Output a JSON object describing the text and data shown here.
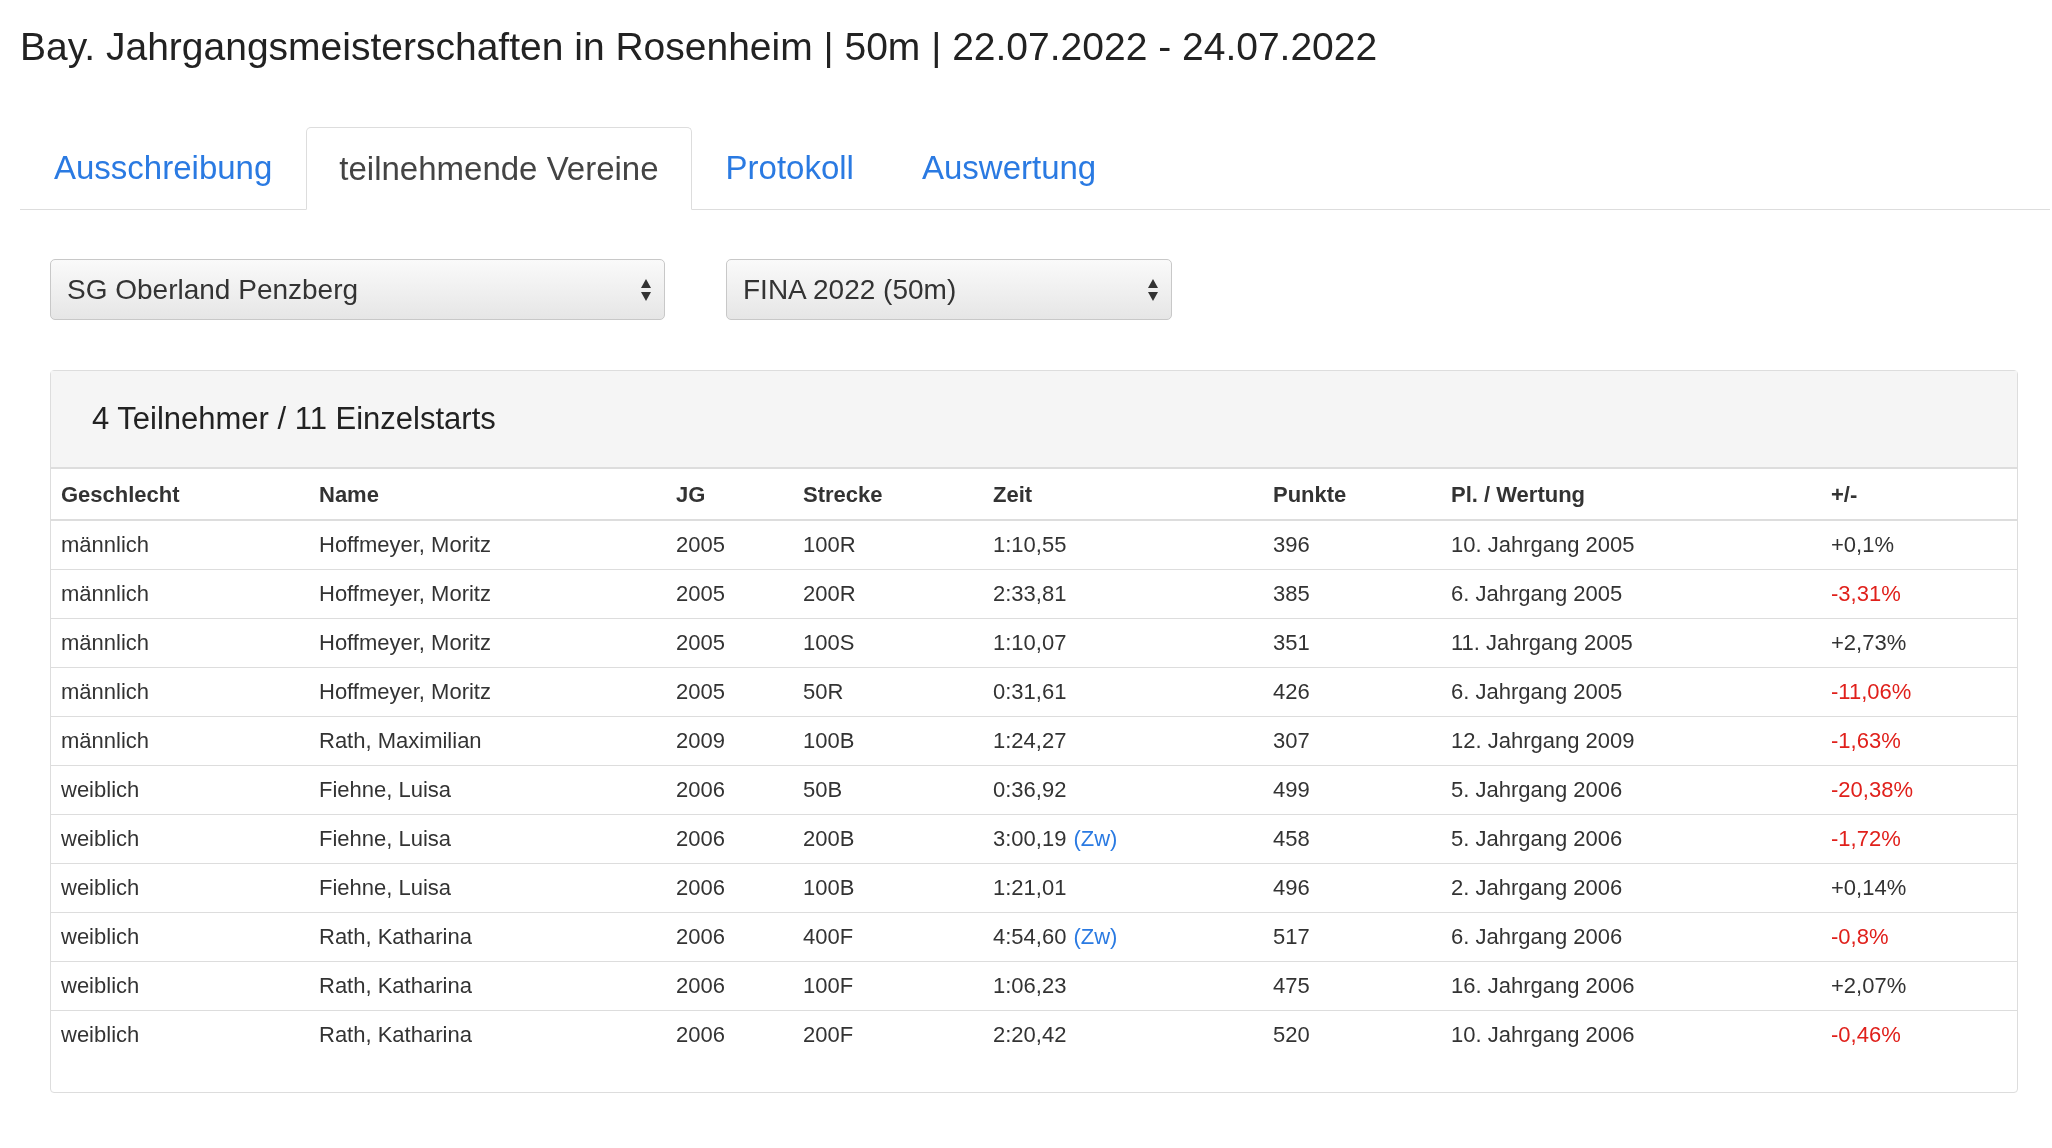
{
  "title": "Bay. Jahrgangsmeisterschaften in Rosenheim | 50m | 22.07.2022 - 24.07.2022",
  "tabs": [
    {
      "label": "Ausschreibung",
      "selected": false
    },
    {
      "label": "teilnehmende Vereine",
      "selected": true
    },
    {
      "label": "Protokoll",
      "selected": false
    },
    {
      "label": "Auswertung",
      "selected": false
    }
  ],
  "selects": [
    {
      "value": "SG Oberland Penzberg"
    },
    {
      "value": "FINA 2022 (50m)"
    }
  ],
  "panel": {
    "heading": "4 Teilnehmer / 11 Einzelstarts",
    "columns": [
      "Geschlecht",
      "Name",
      "JG",
      "Strecke",
      "Zeit",
      "Punkte",
      "Pl. / Wertung",
      "+/-"
    ],
    "rows": [
      {
        "gender": "männlich",
        "name": "Hoffmeyer, Moritz",
        "jg": "2005",
        "distance": "100R",
        "time": "1:10,55",
        "points": "396",
        "rank": "10. Jahrgang 2005",
        "diff": "+0,1%",
        "negative": false
      },
      {
        "gender": "männlich",
        "name": "Hoffmeyer, Moritz",
        "jg": "2005",
        "distance": "200R",
        "time": "2:33,81",
        "points": "385",
        "rank": "6. Jahrgang 2005",
        "diff": "-3,31%",
        "negative": true
      },
      {
        "gender": "männlich",
        "name": "Hoffmeyer, Moritz",
        "jg": "2005",
        "distance": "100S",
        "time": "1:10,07",
        "points": "351",
        "rank": "11. Jahrgang 2005",
        "diff": "+2,73%",
        "negative": false
      },
      {
        "gender": "männlich",
        "name": "Hoffmeyer, Moritz",
        "jg": "2005",
        "distance": "50R",
        "time": "0:31,61",
        "points": "426",
        "rank": "6. Jahrgang 2005",
        "diff": "-11,06%",
        "negative": true
      },
      {
        "gender": "männlich",
        "name": "Rath, Maximilian",
        "jg": "2009",
        "distance": "100B",
        "time": "1:24,27",
        "points": "307",
        "rank": "12. Jahrgang 2009",
        "diff": "-1,63%",
        "negative": true
      },
      {
        "gender": "weiblich",
        "name": "Fiehne, Luisa",
        "jg": "2006",
        "distance": "50B",
        "time": "0:36,92",
        "points": "499",
        "rank": "5. Jahrgang 2006",
        "diff": "-20,38%",
        "negative": true
      },
      {
        "gender": "weiblich",
        "name": "Fiehne, Luisa",
        "jg": "2006",
        "distance": "200B",
        "time": "3:00,19",
        "split_link": "(Zw)",
        "points": "458",
        "rank": "5. Jahrgang 2006",
        "diff": "-1,72%",
        "negative": true
      },
      {
        "gender": "weiblich",
        "name": "Fiehne, Luisa",
        "jg": "2006",
        "distance": "100B",
        "time": "1:21,01",
        "points": "496",
        "rank": "2. Jahrgang 2006",
        "diff": "+0,14%",
        "negative": false
      },
      {
        "gender": "weiblich",
        "name": "Rath, Katharina",
        "jg": "2006",
        "distance": "400F",
        "time": "4:54,60",
        "split_link": "(Zw)",
        "points": "517",
        "rank": "6. Jahrgang 2006",
        "diff": "-0,8%",
        "negative": true
      },
      {
        "gender": "weiblich",
        "name": "Rath, Katharina",
        "jg": "2006",
        "distance": "100F",
        "time": "1:06,23",
        "points": "475",
        "rank": "16. Jahrgang 2006",
        "diff": "+2,07%",
        "negative": false
      },
      {
        "gender": "weiblich",
        "name": "Rath, Katharina",
        "jg": "2006",
        "distance": "200F",
        "time": "2:20,42",
        "points": "520",
        "rank": "10. Jahrgang 2006",
        "diff": "-0,46%",
        "negative": true
      }
    ]
  }
}
